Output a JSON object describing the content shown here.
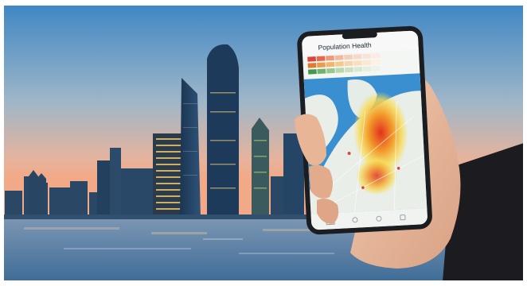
{
  "phone": {
    "app_title": "Population Health",
    "legend_rows": [
      {
        "colors": [
          "#d9473c",
          "#e46a4a",
          "#ee9a7a",
          "#f2b9a0",
          "#f5cdb8",
          "#f7d9c8",
          "#f9e3d6",
          "#fbece3"
        ]
      },
      {
        "colors": [
          "#e07b2f",
          "#ea9c4a",
          "#f0b66e",
          "#f4c98e",
          "#f6d6a8",
          "#f8e0bd",
          "#fae9d0",
          "#fcf1e2"
        ]
      },
      {
        "colors": [
          "#3f9b4a",
          "#6fb36b",
          "#98c88e",
          "#b7d7ad",
          "#c9e1c2",
          "#d8e9d2",
          "#e3efdf",
          "#ecf4e9"
        ]
      }
    ],
    "map_colors": {
      "water": "#3a8fd0",
      "land": "#e9eee8",
      "heat_core": "#e2321f",
      "heat_mid": "#f29a2a",
      "heat_edge": "#f7dd5a"
    }
  },
  "colors": {
    "sky_top": "#3f87c4",
    "sky_mid": "#9fb6c8",
    "horizon": "#f2a987",
    "water": "#4f7aa3"
  }
}
